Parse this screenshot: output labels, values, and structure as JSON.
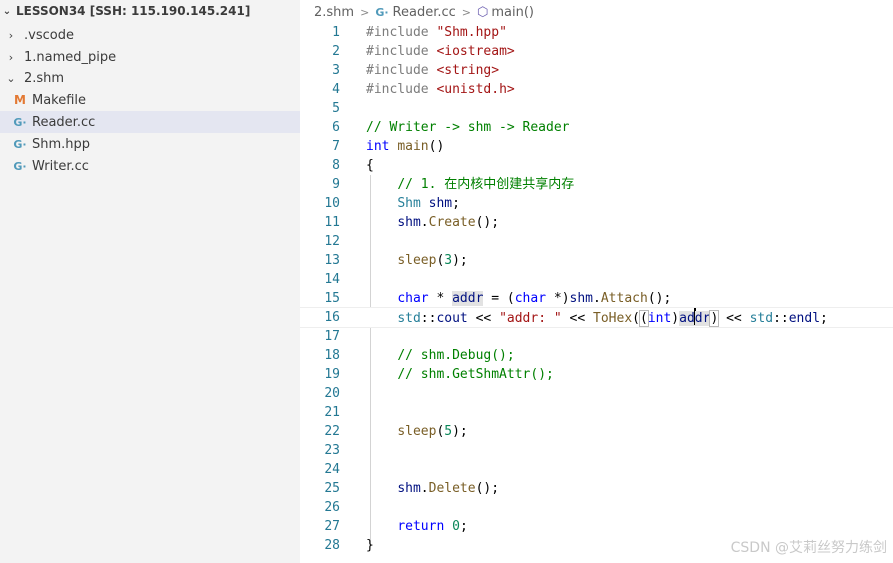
{
  "explorer": {
    "title": "LESSON34 [SSH: 115.190.145.241]",
    "items": [
      {
        "label": ".vscode",
        "twist": "›",
        "icon": ""
      },
      {
        "label": "1.named_pipe",
        "twist": "›",
        "icon": ""
      },
      {
        "label": "2.shm",
        "twist": "⌄",
        "icon": ""
      },
      {
        "label": "Makefile",
        "twist": "",
        "icon": "M"
      },
      {
        "label": "Reader.cc",
        "twist": "",
        "icon": "G·"
      },
      {
        "label": "Shm.hpp",
        "twist": "",
        "icon": "G·"
      },
      {
        "label": "Writer.cc",
        "twist": "",
        "icon": "G·"
      }
    ]
  },
  "breadcrumb": {
    "folder": "2.shm",
    "file": "Reader.cc",
    "symbol": "main()",
    "sep": ">"
  },
  "lines": [
    {
      "n": "1",
      "tokens": [
        [
          "pre",
          "#include "
        ],
        [
          "str",
          "\"Shm.hpp\""
        ]
      ]
    },
    {
      "n": "2",
      "tokens": [
        [
          "pre",
          "#include "
        ],
        [
          "str",
          "<iostream>"
        ]
      ]
    },
    {
      "n": "3",
      "tokens": [
        [
          "pre",
          "#include "
        ],
        [
          "str",
          "<string>"
        ]
      ]
    },
    {
      "n": "4",
      "tokens": [
        [
          "pre",
          "#include "
        ],
        [
          "str",
          "<unistd.h>"
        ]
      ]
    },
    {
      "n": "5",
      "tokens": []
    },
    {
      "n": "6",
      "tokens": [
        [
          "cmt",
          "// Writer -> shm -> Reader"
        ]
      ]
    },
    {
      "n": "7",
      "tokens": [
        [
          "kw",
          "int"
        ],
        [
          "plain",
          " "
        ],
        [
          "fn",
          "main"
        ],
        [
          "plain",
          "()"
        ]
      ]
    },
    {
      "n": "8",
      "tokens": [
        [
          "plain",
          "{"
        ]
      ]
    },
    {
      "n": "9",
      "tokens": [
        [
          "plain",
          "    "
        ],
        [
          "cmt",
          "// 1. 在内核中创建共享内存"
        ]
      ]
    },
    {
      "n": "10",
      "tokens": [
        [
          "plain",
          "    "
        ],
        [
          "type",
          "Shm"
        ],
        [
          "plain",
          " "
        ],
        [
          "var",
          "shm"
        ],
        [
          "plain",
          ";"
        ]
      ]
    },
    {
      "n": "11",
      "tokens": [
        [
          "plain",
          "    "
        ],
        [
          "var",
          "shm"
        ],
        [
          "plain",
          "."
        ],
        [
          "fn",
          "Create"
        ],
        [
          "plain",
          "();"
        ]
      ]
    },
    {
      "n": "12",
      "tokens": []
    },
    {
      "n": "13",
      "tokens": [
        [
          "plain",
          "    "
        ],
        [
          "fn",
          "sleep"
        ],
        [
          "plain",
          "("
        ],
        [
          "num",
          "3"
        ],
        [
          "plain",
          ");"
        ]
      ]
    },
    {
      "n": "14",
      "tokens": []
    },
    {
      "n": "15",
      "tokens": [
        [
          "plain",
          "    "
        ],
        [
          "kw",
          "char"
        ],
        [
          "plain",
          " * "
        ],
        [
          "var-hl",
          "addr"
        ],
        [
          "plain",
          " = ("
        ],
        [
          "kw",
          "char"
        ],
        [
          "plain",
          " *)"
        ],
        [
          "var",
          "shm"
        ],
        [
          "plain",
          "."
        ],
        [
          "fn",
          "Attach"
        ],
        [
          "plain",
          "();"
        ]
      ]
    },
    {
      "n": "16",
      "tokens": [
        [
          "plain",
          "    "
        ],
        [
          "type",
          "std"
        ],
        [
          "plain",
          "::"
        ],
        [
          "var",
          "cout"
        ],
        [
          "plain",
          " << "
        ],
        [
          "str",
          "\"addr: \""
        ],
        [
          "plain",
          " << "
        ],
        [
          "fn",
          "ToHex"
        ],
        [
          "plain",
          "("
        ],
        [
          "br",
          "("
        ],
        [
          "kw",
          "int"
        ],
        [
          "plain",
          ")"
        ],
        [
          "var-hl",
          "ad"
        ],
        [
          "cursor",
          ""
        ],
        [
          "var-hl",
          "dr"
        ],
        [
          "br",
          ")"
        ],
        [
          "plain",
          " << "
        ],
        [
          "type",
          "std"
        ],
        [
          "plain",
          "::"
        ],
        [
          "var",
          "endl"
        ],
        [
          "plain",
          ";"
        ]
      ]
    },
    {
      "n": "17",
      "tokens": []
    },
    {
      "n": "18",
      "tokens": [
        [
          "plain",
          "    "
        ],
        [
          "cmt",
          "// shm.Debug();"
        ]
      ]
    },
    {
      "n": "19",
      "tokens": [
        [
          "plain",
          "    "
        ],
        [
          "cmt",
          "// shm.GetShmAttr();"
        ]
      ]
    },
    {
      "n": "20",
      "tokens": []
    },
    {
      "n": "21",
      "tokens": []
    },
    {
      "n": "22",
      "tokens": [
        [
          "plain",
          "    "
        ],
        [
          "fn",
          "sleep"
        ],
        [
          "plain",
          "("
        ],
        [
          "num",
          "5"
        ],
        [
          "plain",
          ");"
        ]
      ]
    },
    {
      "n": "23",
      "tokens": []
    },
    {
      "n": "24",
      "tokens": []
    },
    {
      "n": "25",
      "tokens": [
        [
          "plain",
          "    "
        ],
        [
          "var",
          "shm"
        ],
        [
          "plain",
          "."
        ],
        [
          "fn",
          "Delete"
        ],
        [
          "plain",
          "();"
        ]
      ]
    },
    {
      "n": "26",
      "tokens": []
    },
    {
      "n": "27",
      "tokens": [
        [
          "plain",
          "    "
        ],
        [
          "kw",
          "return"
        ],
        [
          "plain",
          " "
        ],
        [
          "num",
          "0"
        ],
        [
          "plain",
          ";"
        ]
      ]
    },
    {
      "n": "28",
      "tokens": [
        [
          "plain",
          "}"
        ]
      ]
    }
  ],
  "current_line": "16",
  "watermark": "CSDN @艾莉丝努力练剑"
}
